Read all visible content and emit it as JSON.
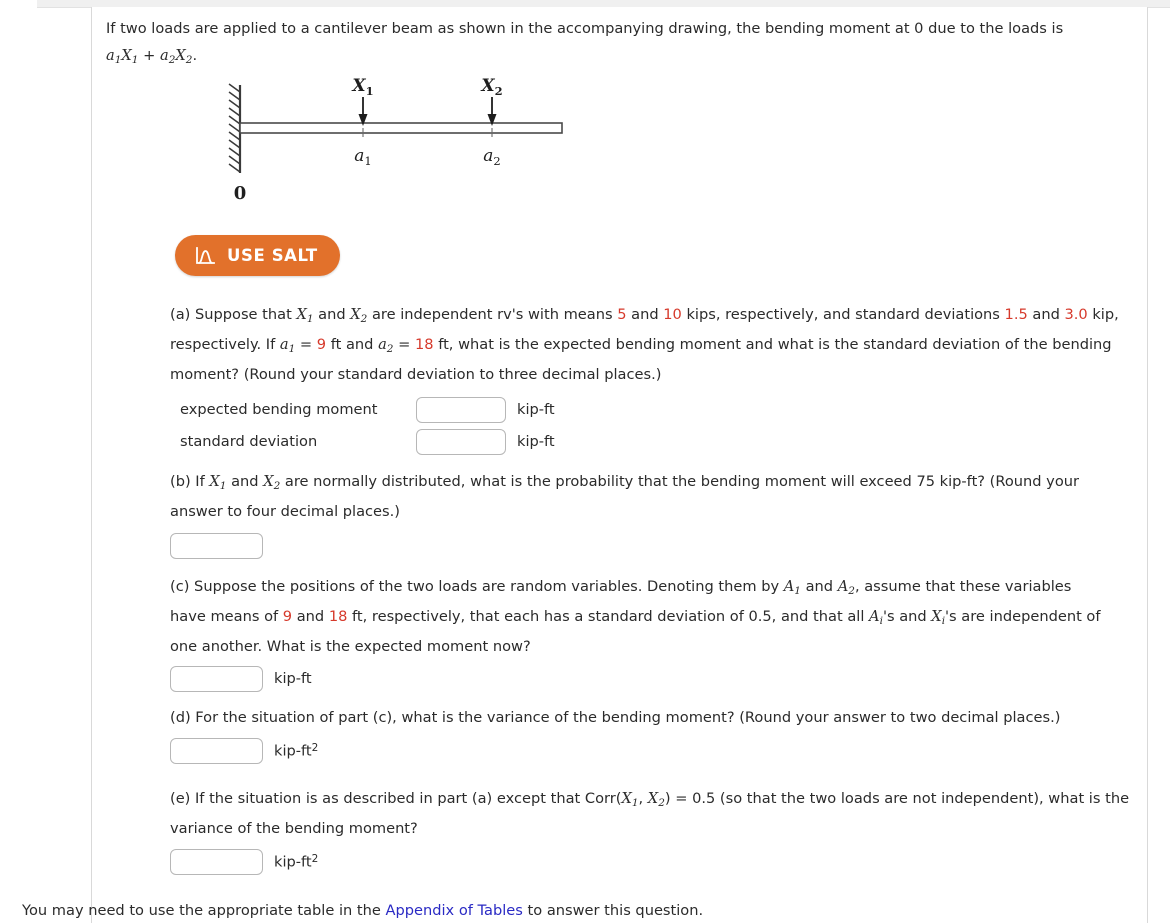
{
  "prompt": {
    "line1": "If two loads are applied to a cantilever beam as shown in the accompanying drawing, the bending moment at 0 due to the loads is",
    "formula_a1": "a",
    "formula_sub1": "1",
    "formula_x1": "X",
    "formula_x1sub": "1",
    "formula_plus": " + ",
    "formula_a2": "a",
    "formula_sub2": "2",
    "formula_x2": "X",
    "formula_x2sub": "2",
    "formula_period": "."
  },
  "diagram": {
    "label_x1": "X",
    "label_x1_sub": "1",
    "label_x2": "X",
    "label_x2_sub": "2",
    "label_a1": "a",
    "label_a1_sub": "1",
    "label_a2": "a",
    "label_a2_sub": "2",
    "label_origin": "0",
    "alt": "cantilever beam fixed at left wall with two downward point loads"
  },
  "salt_button": {
    "label": "USE SALT",
    "icon": "distribution-curve-icon",
    "bg_color": "#e2712b",
    "text_color": "#ffffff"
  },
  "colors": {
    "highlight_red": "#d6392b",
    "link_blue": "#2a2ac4",
    "body_text": "#2b2b2b",
    "input_border": "#b7b7b7"
  },
  "parts": {
    "a": {
      "marker": "(a) Suppose that ",
      "t1": " and ",
      "t2": " are independent rv's with means ",
      "mean1": "5",
      "t3": " and ",
      "mean2": "10",
      "t4": " kips, respectively, and standard deviations ",
      "sd1": "1.5",
      "t5": " and ",
      "sd2": "3.0",
      "t6": " kip, respectively. If ",
      "t7": " = ",
      "a1_val": "9",
      "t8": " ft and ",
      "t9": " = ",
      "a2_val": "18",
      "t10": " ft, what is the expected bending moment and what is the standard deviation of the bending moment? (Round your standard deviation to three decimal places.)",
      "answer1_label": "expected bending moment",
      "answer1_value": "",
      "answer1_unit": "kip-ft",
      "answer2_label": "standard deviation",
      "answer2_value": "",
      "answer2_unit": "kip-ft"
    },
    "b": {
      "marker": "(b) If ",
      "t1": " and ",
      "t2": " are normally distributed, what is the probability that the bending moment will exceed 75 kip-ft? (Round your answer to four decimal places.)",
      "answer_value": ""
    },
    "c": {
      "marker": "(c) Suppose the positions of the two loads are random variables. Denoting them by ",
      "t1": " and ",
      "t2": ", assume that these variables have means of ",
      "mean1": "9",
      "t3": " and ",
      "mean2": "18",
      "t4": " ft, respectively, that each has a standard deviation of 0.5, and that all ",
      "t5": "'s and ",
      "t6": "'s are independent of one another. What is the expected moment now?",
      "answer_value": "",
      "answer_unit": "kip-ft"
    },
    "d": {
      "marker": "(d) For the situation of part (c), what is the variance of the bending moment? (Round your answer to two decimal places.)",
      "answer_value": "",
      "answer_unit": "kip-ft",
      "answer_unit_sup": "2"
    },
    "e": {
      "marker": "(e) If the situation is as described in part (a) except that Corr(",
      "t1": ", ",
      "t2": ") = 0.5 (so that the two loads are not independent), what is the variance of the bending moment?",
      "answer_value": "",
      "answer_unit": "kip-ft",
      "answer_unit_sup": "2"
    }
  },
  "footer": {
    "before": "You may need to use the appropriate table in the ",
    "link": "Appendix of Tables",
    "after": " to answer this question."
  }
}
